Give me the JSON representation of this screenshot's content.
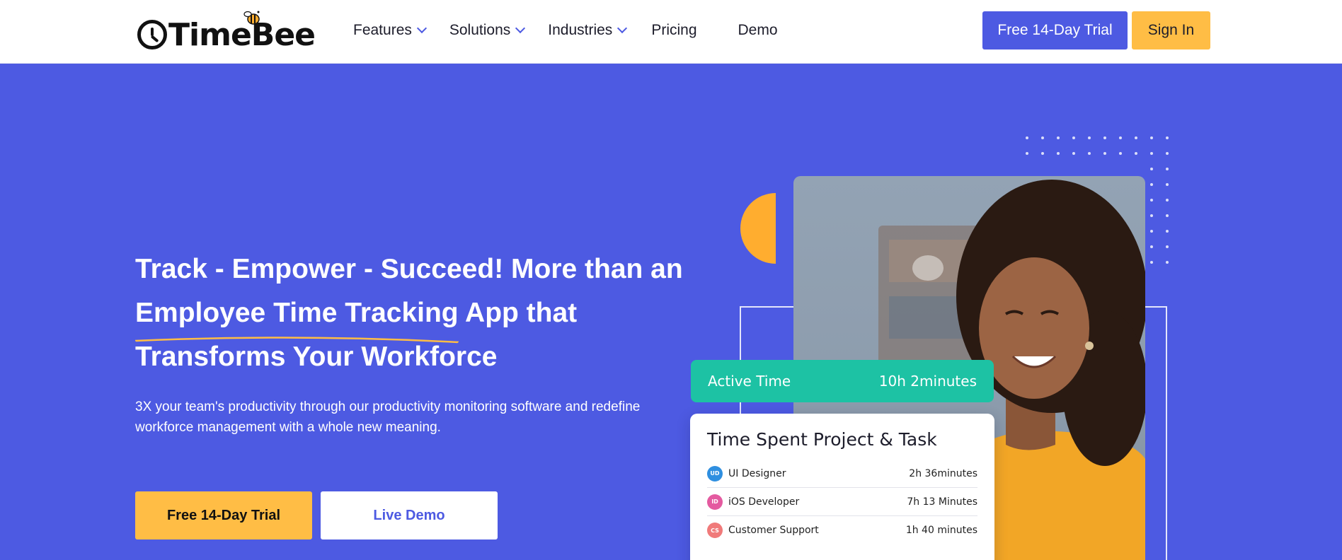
{
  "brand": {
    "name": "TimeBee"
  },
  "nav": {
    "features": "Features",
    "solutions": "Solutions",
    "industries": "Industries",
    "pricing": "Pricing",
    "demo": "Demo"
  },
  "header_buttons": {
    "trial": "Free 14-Day Trial",
    "signin": "Sign In"
  },
  "hero": {
    "headline_part1": "Track - Empower - Succeed! More than an ",
    "headline_highlight": "Employee Time Tracking",
    "headline_part2": " App that Transforms Your Workforce",
    "subtext": "3X your team's productivity through our productivity monitoring software and redefine workforce management with a whole new meaning.",
    "cta_trial": "Free 14-Day Trial",
    "cta_demo": "Live Demo"
  },
  "active_time": {
    "label": "Active Time",
    "value": "10h 2minutes"
  },
  "time_spent": {
    "title": "Time Spent Project & Task",
    "rows": [
      {
        "badge": "UD",
        "badge_color": "#2f8fe0",
        "name": "UI Designer",
        "time": "2h 36minutes"
      },
      {
        "badge": "ID",
        "badge_color": "#e45aa0",
        "name": "iOS Developer",
        "time": "7h 13 Minutes"
      },
      {
        "badge": "CS",
        "badge_color": "#f07a7a",
        "name": "Customer Support",
        "time": "1h 40 minutes"
      }
    ]
  },
  "colors": {
    "primary": "#4d5ae2",
    "accent": "#ffbd45",
    "teal": "#1dc2a4"
  },
  "icons": {
    "logo": "stopwatch-icon",
    "bee": "bee-icon",
    "chevron": "chevron-down-icon"
  }
}
